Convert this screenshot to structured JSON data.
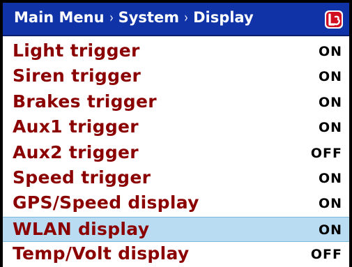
{
  "header": {
    "breadcrumb": [
      "Main Menu",
      "System",
      "Display"
    ],
    "separator": "›",
    "logo_icon": "l3-logo-icon",
    "background_color": "#1033a8"
  },
  "menu": {
    "label_color": "#8b0000",
    "selected_color": "#b9dcf2",
    "items": [
      {
        "label": "Light trigger",
        "value": "ON",
        "selected": false
      },
      {
        "label": "Siren trigger",
        "value": "ON",
        "selected": false
      },
      {
        "label": "Brakes trigger",
        "value": "ON",
        "selected": false
      },
      {
        "label": "Aux1 trigger",
        "value": "ON",
        "selected": false
      },
      {
        "label": "Aux2 trigger",
        "value": "OFF",
        "selected": false
      },
      {
        "label": "Speed trigger",
        "value": "ON",
        "selected": false
      },
      {
        "label": "GPS/Speed display",
        "value": "ON",
        "selected": false
      },
      {
        "label": "WLAN display",
        "value": "ON",
        "selected": true
      },
      {
        "label": "Temp/Volt display",
        "value": "OFF",
        "selected": false
      }
    ]
  }
}
